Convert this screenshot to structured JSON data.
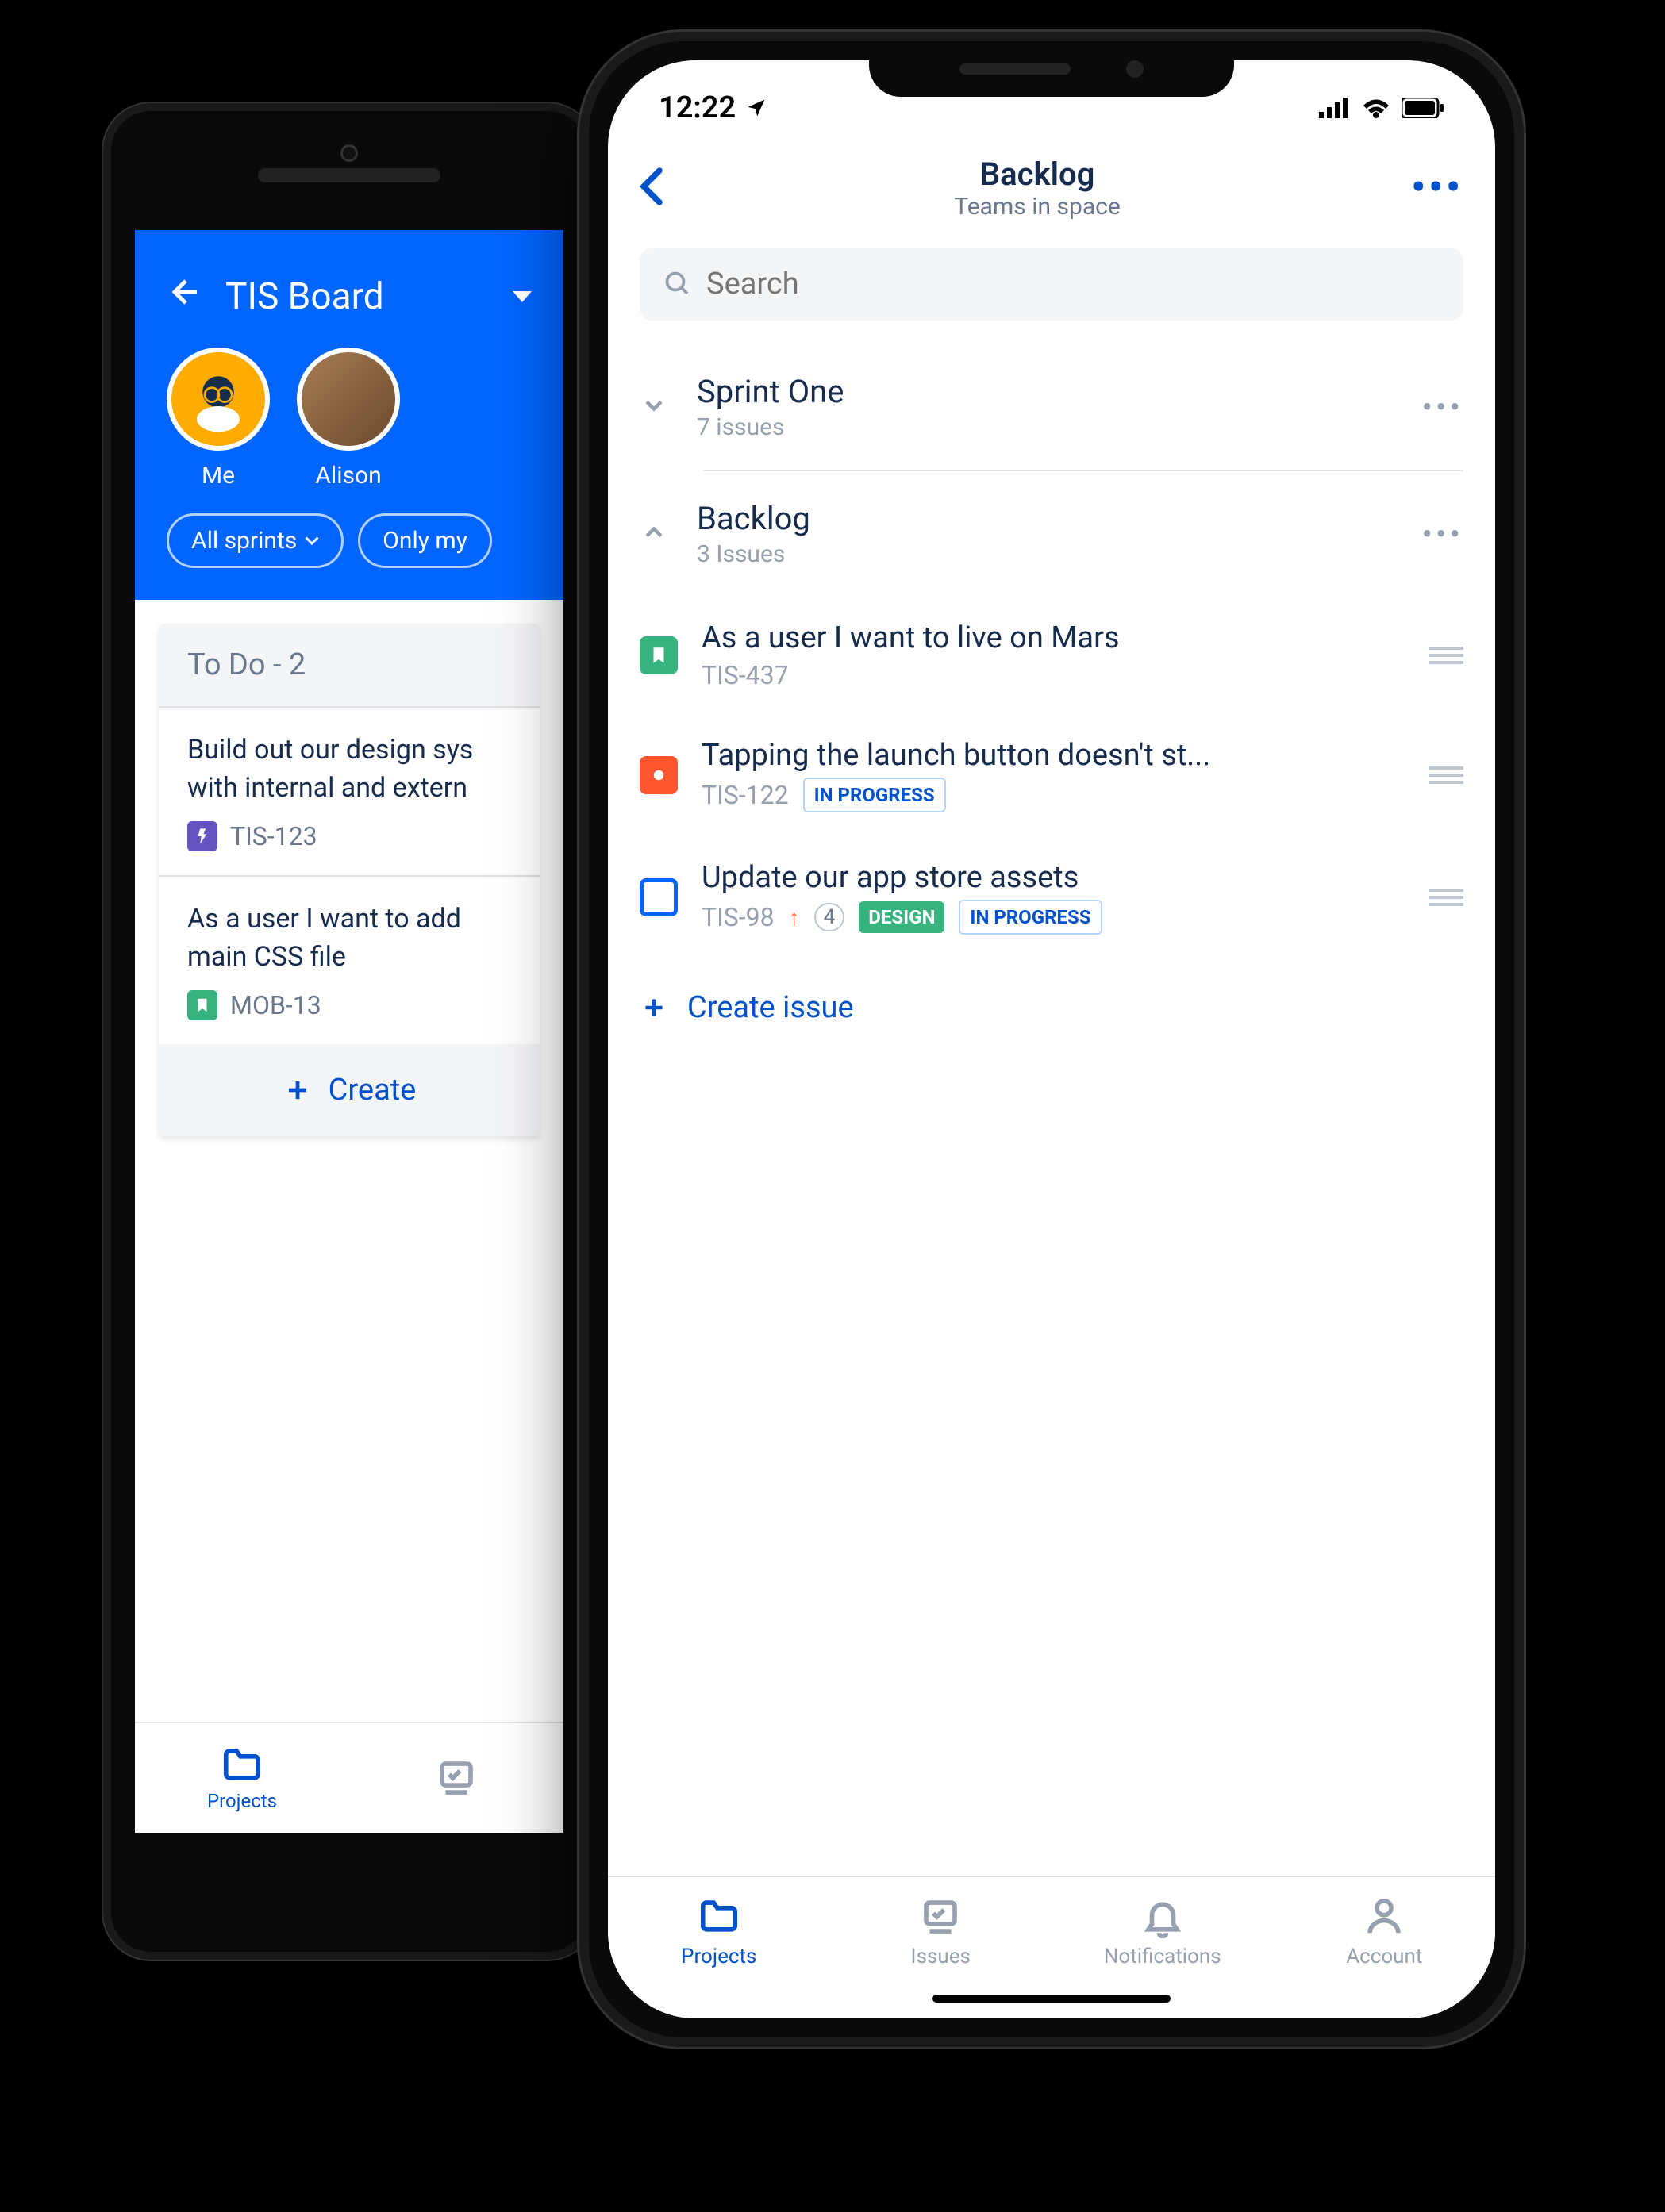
{
  "android": {
    "board_title": "TIS Board",
    "avatars": [
      {
        "label": "Me"
      },
      {
        "label": "Alison"
      }
    ],
    "chips": [
      "All sprints",
      "Only my"
    ],
    "column_header": "To Do - 2",
    "cards": [
      {
        "title": "Build out our design sys with internal and extern",
        "key": "TIS-123",
        "type": "epic"
      },
      {
        "title": "As a user I want to add main CSS file",
        "key": "MOB-13",
        "type": "story"
      }
    ],
    "create_label": "Create",
    "tabs": [
      "Projects"
    ]
  },
  "ios": {
    "statusbar": {
      "time": "12:22"
    },
    "nav": {
      "title": "Backlog",
      "subtitle": "Teams in space"
    },
    "search_placeholder": "Search",
    "sections": [
      {
        "title": "Sprint One",
        "subtitle": "7 issues",
        "expanded": false
      },
      {
        "title": "Backlog",
        "subtitle": "3 Issues",
        "expanded": true
      }
    ],
    "issues": [
      {
        "title": "As a user I want to live on Mars",
        "key": "TIS-437",
        "type": "story",
        "statuses": []
      },
      {
        "title": "Tapping the launch button doesn't st...",
        "key": "TIS-122",
        "type": "bug",
        "statuses": [
          "IN PROGRESS"
        ]
      },
      {
        "title": "Update our app store assets",
        "key": "TIS-98",
        "type": "task",
        "priority_up": true,
        "story_points": "4",
        "statuses": [
          "DESIGN",
          "IN PROGRESS"
        ]
      }
    ],
    "create_label": "Create issue",
    "tabs": [
      "Projects",
      "Issues",
      "Notifications",
      "Account"
    ]
  }
}
